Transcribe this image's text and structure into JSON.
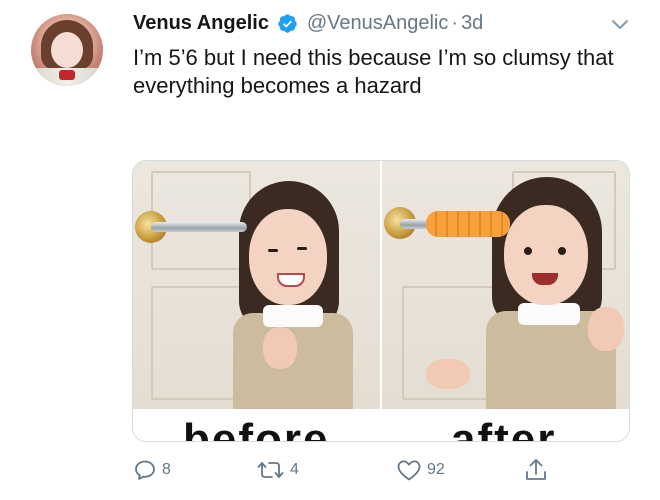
{
  "tweet": {
    "display_name": "Venus Angelic",
    "handle": "@VenusAngelic",
    "separator": "·",
    "time": "3d",
    "text": "I’m 5’6 but I need this because I’m so clumsy that everything becomes a hazard",
    "media": {
      "left_label": "before",
      "right_label": "after"
    }
  },
  "actions": {
    "reply_count": "8",
    "retweet_count": "4",
    "like_count": "92"
  },
  "icons": {
    "verified": "verified-badge-icon",
    "caret": "chevron-down-icon",
    "reply": "reply-icon",
    "retweet": "retweet-icon",
    "like": "heart-icon",
    "share": "share-icon"
  },
  "colors": {
    "verified_blue": "#1da1f2",
    "secondary_text": "#657786",
    "primary_text": "#14171a"
  }
}
